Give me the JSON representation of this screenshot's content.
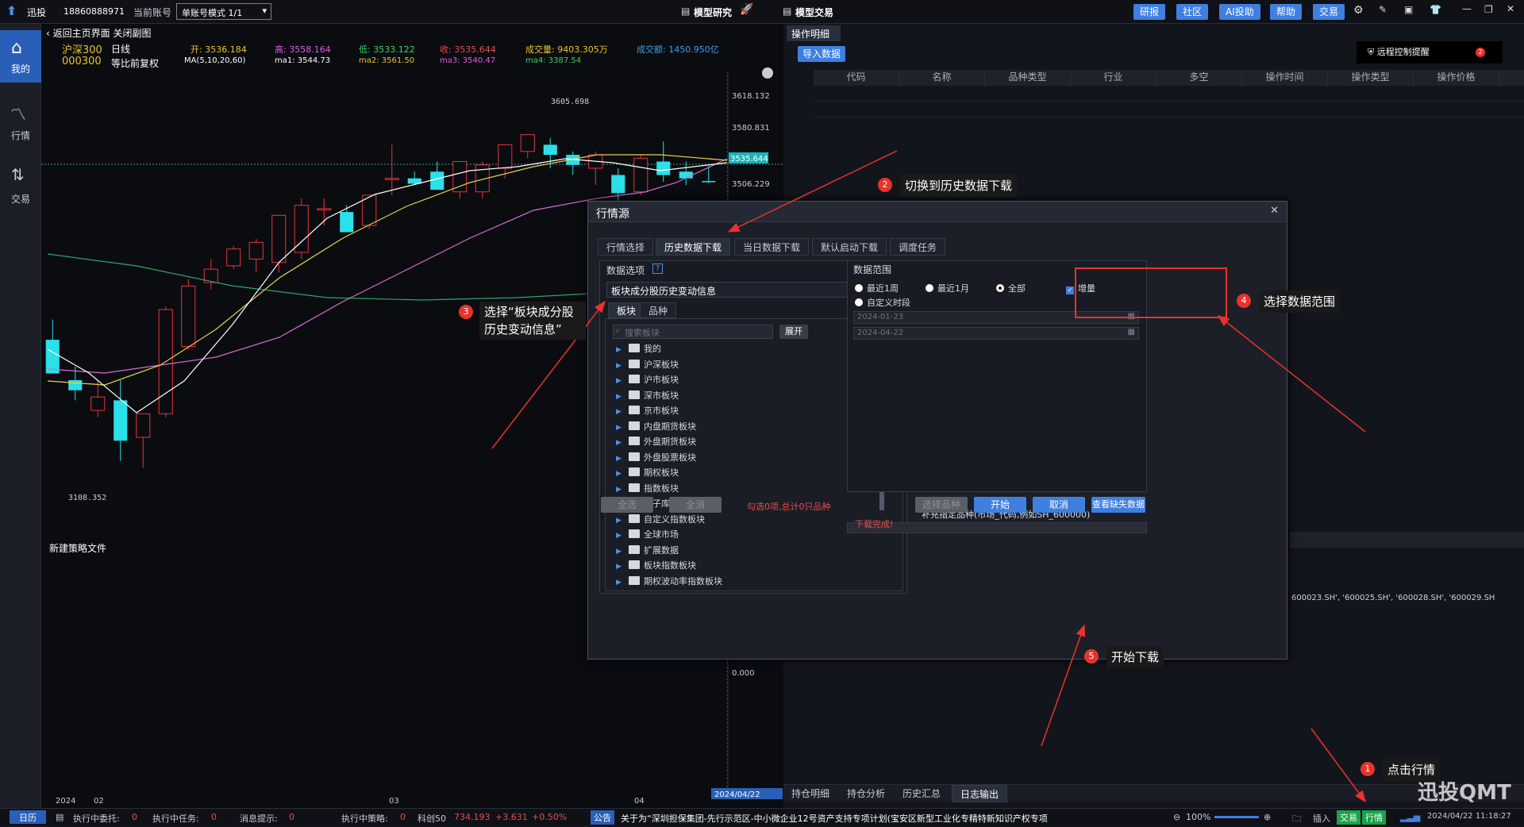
{
  "topbar": {
    "brand": "迅投",
    "phone": "18860888971",
    "account_label": "当前账号",
    "account_mode": "单账号模式 1/1",
    "model_research": "模型研究",
    "model_trade": "模型交易",
    "buttons": [
      "研报",
      "社区",
      "AI投助",
      "帮助",
      "交易"
    ]
  },
  "sidebar": {
    "items": [
      {
        "label": "我的",
        "icon": "home-icon"
      },
      {
        "label": "行情",
        "icon": "chart-icon"
      },
      {
        "label": "交易",
        "icon": "trade-icon"
      }
    ]
  },
  "chart": {
    "back_label": "返回主页界面 关闭副图",
    "index_name": "沪深300",
    "index_code": "000300",
    "period": "日线",
    "adjust": "等比前复权",
    "open": "开: 3536.184",
    "high": "高: 3558.164",
    "low": "低: 3533.122",
    "close": "收: 3535.644",
    "volume": "成交量: 9403.305万",
    "amount": "成交额: 1450.950亿",
    "ma_label": "MA(5,10,20,60)",
    "ma1": "ma1: 3544.73",
    "ma2": "ma2: 3561.50",
    "ma3": "ma3: 3540.47",
    "ma4": "ma4: 3387.54",
    "max_label": "3605.698",
    "min_label": "3108.352",
    "price_axis": [
      "3618.132",
      "3580.831",
      "3535.644",
      "3506.229",
      "0.000"
    ],
    "date_axis": [
      "2024",
      "02",
      "03",
      "04"
    ],
    "current_date": "2024/04/22",
    "new_strategy": "新建策略文件"
  },
  "chart_data": {
    "type": "candlestick",
    "title": "",
    "ylim": [
      3050,
      3640
    ],
    "candles": [
      {
        "o": 3300,
        "h": 3330,
        "l": 3250,
        "c": 3250
      },
      {
        "o": 3240,
        "h": 3260,
        "l": 3210,
        "c": 3225
      },
      {
        "o": 3195,
        "h": 3240,
        "l": 3185,
        "c": 3215
      },
      {
        "o": 3210,
        "h": 3240,
        "l": 3120,
        "c": 3150
      },
      {
        "o": 3155,
        "h": 3185,
        "l": 3110,
        "c": 3190
      },
      {
        "o": 3190,
        "h": 3350,
        "l": 3185,
        "c": 3345
      },
      {
        "o": 3290,
        "h": 3390,
        "l": 3285,
        "c": 3380
      },
      {
        "o": 3385,
        "h": 3420,
        "l": 3375,
        "c": 3405
      },
      {
        "o": 3410,
        "h": 3440,
        "l": 3405,
        "c": 3435
      },
      {
        "o": 3420,
        "h": 3450,
        "l": 3400,
        "c": 3445
      },
      {
        "o": 3415,
        "h": 3470,
        "l": 3400,
        "c": 3485
      },
      {
        "o": 3430,
        "h": 3510,
        "l": 3420,
        "c": 3500
      },
      {
        "o": 3495,
        "h": 3510,
        "l": 3470,
        "c": 3495
      },
      {
        "o": 3490,
        "h": 3500,
        "l": 3465,
        "c": 3460
      },
      {
        "o": 3470,
        "h": 3510,
        "l": 3465,
        "c": 3515
      },
      {
        "o": 3540,
        "h": 3590,
        "l": 3515,
        "c": 3540
      },
      {
        "o": 3540,
        "h": 3550,
        "l": 3530,
        "c": 3532
      },
      {
        "o": 3550,
        "h": 3565,
        "l": 3530,
        "c": 3523
      },
      {
        "o": 3520,
        "h": 3560,
        "l": 3510,
        "c": 3565
      },
      {
        "o": 3520,
        "h": 3565,
        "l": 3510,
        "c": 3560
      },
      {
        "o": 3555,
        "h": 3575,
        "l": 3540,
        "c": 3590
      },
      {
        "o": 3580,
        "h": 3605,
        "l": 3570,
        "c": 3605
      },
      {
        "o": 3590,
        "h": 3600,
        "l": 3555,
        "c": 3575
      },
      {
        "o": 3575,
        "h": 3580,
        "l": 3545,
        "c": 3560
      },
      {
        "o": 3555,
        "h": 3580,
        "l": 3530,
        "c": 3575
      },
      {
        "o": 3545,
        "h": 3555,
        "l": 3500,
        "c": 3518
      },
      {
        "o": 3520,
        "h": 3575,
        "l": 3515,
        "c": 3570
      },
      {
        "o": 3565,
        "h": 3595,
        "l": 3535,
        "c": 3545
      },
      {
        "o": 3550,
        "h": 3565,
        "l": 3530,
        "c": 3540
      },
      {
        "o": 3536,
        "h": 3558,
        "l": 3533,
        "c": 3535
      }
    ]
  },
  "right_panel": {
    "panel_title": "操作明细",
    "import_button": "导入数据",
    "remote_alert": "远程控制提醒",
    "remote_badge": "2",
    "columns": [
      "代码",
      "名称",
      "品种类型",
      "行业",
      "多空",
      "操作时间",
      "操作类型",
      "操作价格"
    ],
    "codes_text": "600023.SH', '600025.SH', '600028.SH', '600029.SH",
    "bottom_tabs": [
      "持仓明细",
      "持仓分析",
      "历史汇总",
      "日志输出"
    ]
  },
  "dialog": {
    "title": "行情源",
    "tabs": [
      "行情选择",
      "历史数据下载",
      "当日数据下载",
      "默认启动下载",
      "调度任务"
    ],
    "data_options_label": "数据选项",
    "help_mark": "?",
    "dropdown_value": "板块成分股历史变动信息",
    "subtabs": [
      "板块",
      "品种"
    ],
    "search_placeholder": "搜索板块",
    "expand_button": "展开",
    "tree_items": [
      "我的",
      "沪深板块",
      "沪市板块",
      "深市板块",
      "京市板块",
      "内盘期货板块",
      "外盘期货板块",
      "外盘股票板块",
      "期权板块",
      "指数板块",
      "因子库",
      "自定义指数板块",
      "全球市场",
      "扩展数据",
      "板块指数板块",
      "期权波动率指数板块"
    ],
    "select_all": "全选",
    "select_none": "全消",
    "selection_status": "勾选0项,总计0只品种",
    "range_label": "数据范围",
    "range_options": [
      "最近1周",
      "最近1月",
      "全部",
      "增量",
      "自定义时段"
    ],
    "date_start": "2024-01-23",
    "date_end": "2024-04-22",
    "supplement_label": "补充指定品种(市场_代码,例如SH_600000)",
    "select_variety": "选择品种",
    "start_button": "开始",
    "cancel_button": "取消",
    "missing_button": "查看缺失数据",
    "done_text": "下载完成!"
  },
  "annotations": [
    {
      "num": "1",
      "text": "点击行情"
    },
    {
      "num": "2",
      "text": "切换到历史数据下载"
    },
    {
      "num": "3",
      "text": "选择“板块成分股历史变动信息”"
    },
    {
      "num": "4",
      "text": "选择数据范围"
    },
    {
      "num": "5",
      "text": "开始下载"
    }
  ],
  "statusbar": {
    "calendar": "日历",
    "pending_orders": "执行中委托:",
    "pending_orders_count": "0",
    "running_tasks": "执行中任务:",
    "running_tasks_count": "0",
    "messages": "消息提示:",
    "messages_count": "0",
    "running_strategy": "执行中策略:",
    "running_strategy_count": "0",
    "kc50": "科创50",
    "kc50_value": "734.193",
    "kc50_change": "+3.631",
    "kc50_pct": "+0.50%",
    "notice_tag": "公告",
    "notice_text": "关于为“深圳担保集团-先行示范区-中小微企业12号资产支持专项计划(宝安区新型工业化专精特新知识产权专项",
    "zoom": "100%",
    "plugin": "插入",
    "trade": "交易",
    "market": "行情",
    "datetime": "2024/04/22 11:18:27",
    "watermark": "迅投QMT"
  }
}
